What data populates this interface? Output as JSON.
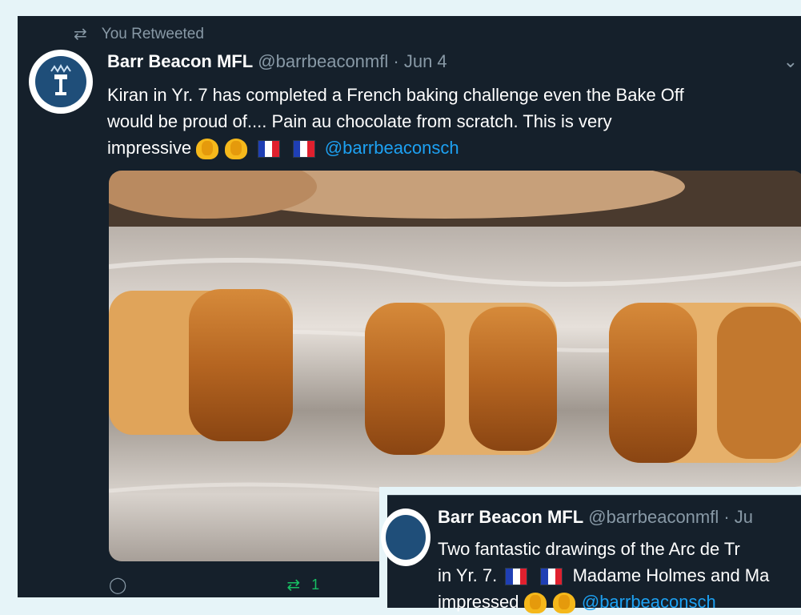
{
  "retweet": {
    "label": "You Retweeted",
    "icon": "retweet-icon"
  },
  "tweet": {
    "display_name": "Barr Beacon MFL",
    "handle": "@barrbeaconmfl",
    "separator": "·",
    "date": "Jun 4",
    "text_line1": "Kiran in Yr. 7 has completed a French baking challenge even the Bake Off",
    "text_line2": "would be proud of.... Pain au chocolate from scratch. This is very",
    "text_line3": "impressive",
    "mention": "@barrbeaconsch",
    "emojis": [
      "clapping-hands",
      "clapping-hands",
      "flag-france",
      "flag-france"
    ]
  },
  "actions": {
    "reply_icon": "reply-icon",
    "retweet_icon": "retweet-icon",
    "retweet_count": "1",
    "retweeted_color": "#17bf63"
  },
  "quoted_tweet": {
    "display_name": "Barr Beacon MFL",
    "handle": "@barrbeaconmfl · Ju",
    "line1": "Two fantastic drawings of the Arc de Tr",
    "line2_prefix": "in Yr. 7.",
    "line2_suffix": "Madame Holmes and Ma",
    "line3_prefix": "impressed",
    "line3_mention": "@barrbeaconsch"
  },
  "colors": {
    "background": "#15202b",
    "accent": "#1da1f2",
    "muted": "#8899a6",
    "text": "#ffffff"
  }
}
